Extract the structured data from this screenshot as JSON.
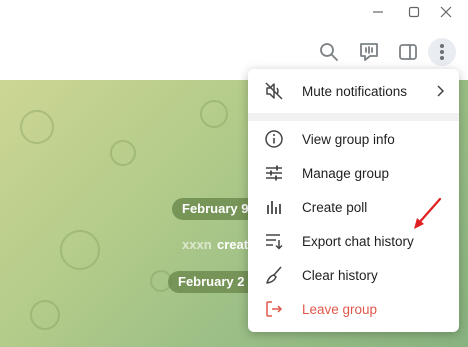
{
  "window": {
    "controls": [
      {
        "name": "minimize-icon"
      },
      {
        "name": "maximize-icon"
      },
      {
        "name": "close-icon"
      }
    ]
  },
  "header": {
    "icons": [
      "search-icon",
      "video-chat-icon",
      "sidebar-toggle-icon",
      "more-vertical-icon"
    ]
  },
  "chat": {
    "dates": [
      "February 9",
      "February 2"
    ],
    "service_message": "created",
    "service_prefix": "xxxn"
  },
  "menu": {
    "items": [
      {
        "label": "Mute notifications",
        "icon": "mute-icon",
        "submenu": true
      },
      {
        "label": "View group info",
        "icon": "info-icon"
      },
      {
        "label": "Manage group",
        "icon": "sliders-icon"
      },
      {
        "label": "Create poll",
        "icon": "poll-icon"
      },
      {
        "label": "Export chat history",
        "icon": "export-icon"
      },
      {
        "label": "Clear history",
        "icon": "broom-icon"
      },
      {
        "label": "Leave group",
        "icon": "leave-icon",
        "danger": true
      }
    ]
  },
  "colors": {
    "accent_danger": "#e0584c",
    "annotation_arrow": "#e02020",
    "chat_bg": "#b4cc8a"
  }
}
